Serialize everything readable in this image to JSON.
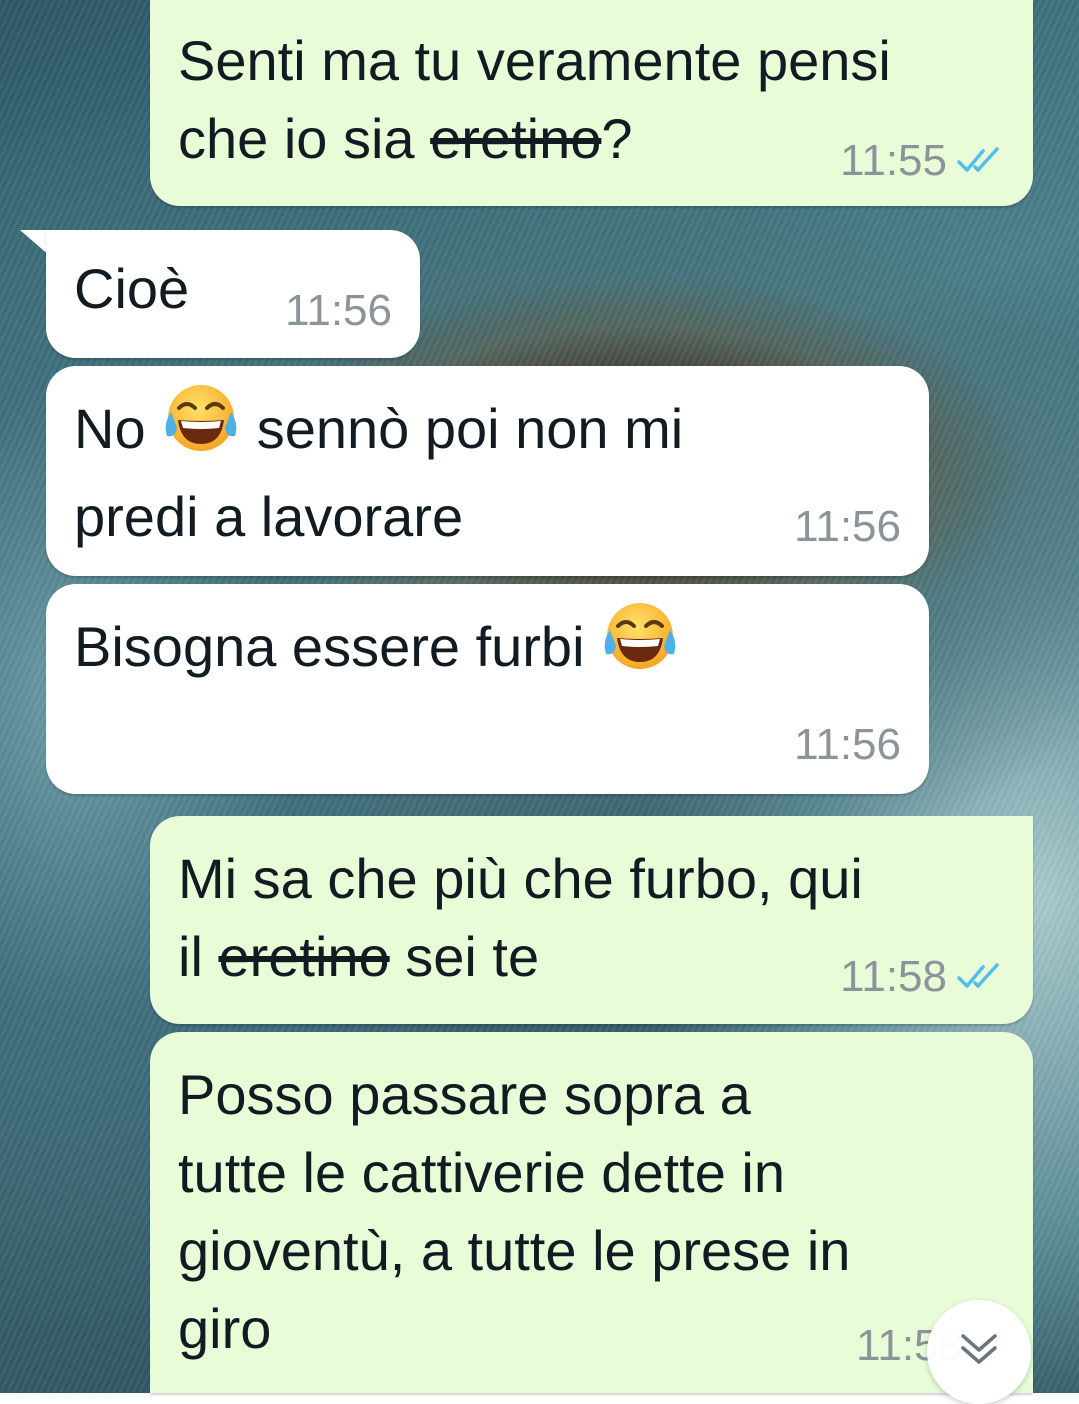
{
  "colors": {
    "outgoing_bubble": "#e7fcd7",
    "incoming_bubble": "#ffffff",
    "timestamp": "#8a9499",
    "read_ticks": "#53bdeb"
  },
  "messages": [
    {
      "direction": "outgoing",
      "parts": {
        "a": "Senti ma tu veramente pensi\nche io sia ",
        "strike": "eretino",
        "b": "?"
      },
      "time": "11:55",
      "status": "read"
    },
    {
      "direction": "incoming",
      "text": "Cioè",
      "time": "11:56"
    },
    {
      "direction": "incoming",
      "parts": {
        "a": "No ",
        "emoji": "face-with-tears-of-joy",
        "b": " sennò poi non mi\npredi a lavorare"
      },
      "time": "11:56"
    },
    {
      "direction": "incoming",
      "parts": {
        "a": "Bisogna essere furbi ",
        "emoji": "face-with-tears-of-joy"
      },
      "time": "11:56"
    },
    {
      "direction": "outgoing",
      "parts": {
        "a": "Mi sa che più che furbo, qui\nil ",
        "strike": "eretino",
        "b": " sei te"
      },
      "time": "11:58",
      "status": "read"
    },
    {
      "direction": "outgoing",
      "text": "Posso passare sopra a\ntutte le cattiverie dette in\ngioventù, a tutte le prese in\ngiro",
      "time": "11:58"
    }
  ],
  "scroll_button": {
    "icon": "double-chevron-down-icon"
  }
}
